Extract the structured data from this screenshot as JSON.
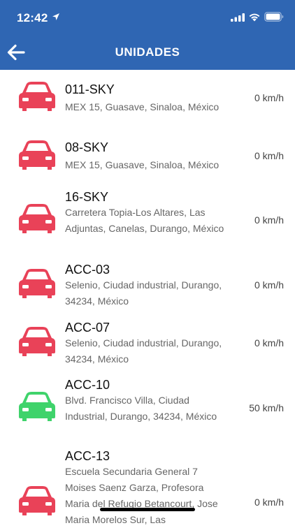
{
  "status_bar": {
    "time": "12:42"
  },
  "nav": {
    "title": "UNIDADES"
  },
  "colors": {
    "header": "#2f66b3",
    "stopped": "#e94258",
    "moving": "#3fd36b"
  },
  "units": [
    {
      "name": "011-SKY",
      "address": "MEX 15, Guasave, Sinaloa, México",
      "speed": "0 km/h",
      "status": "stopped"
    },
    {
      "name": "08-SKY",
      "address": "MEX 15, Guasave, Sinaloa, México",
      "speed": "0 km/h",
      "status": "stopped"
    },
    {
      "name": "16-SKY",
      "address": "Carretera Topia-Los Altares, Las Adjuntas, Canelas, Durango, México",
      "speed": "0 km/h",
      "status": "stopped"
    },
    {
      "name": "ACC-03",
      "address": "Selenio, Ciudad industrial, Durango, 34234, México",
      "speed": "0 km/h",
      "status": "stopped"
    },
    {
      "name": "ACC-07",
      "address": "Selenio, Ciudad industrial, Durango, 34234, México",
      "speed": "0 km/h",
      "status": "stopped"
    },
    {
      "name": "ACC-10",
      "address": "Blvd. Francisco Villa, Ciudad Industrial, Durango, 34234, México",
      "speed": "50 km/h",
      "status": "moving"
    },
    {
      "name": "ACC-13",
      "address": "Escuela Secundaria General 7 Moises Saenz Garza, Profesora Maria del Refugio Betancourt, Jose Maria Morelos Sur, Las",
      "speed": "0 km/h",
      "status": "stopped"
    }
  ]
}
